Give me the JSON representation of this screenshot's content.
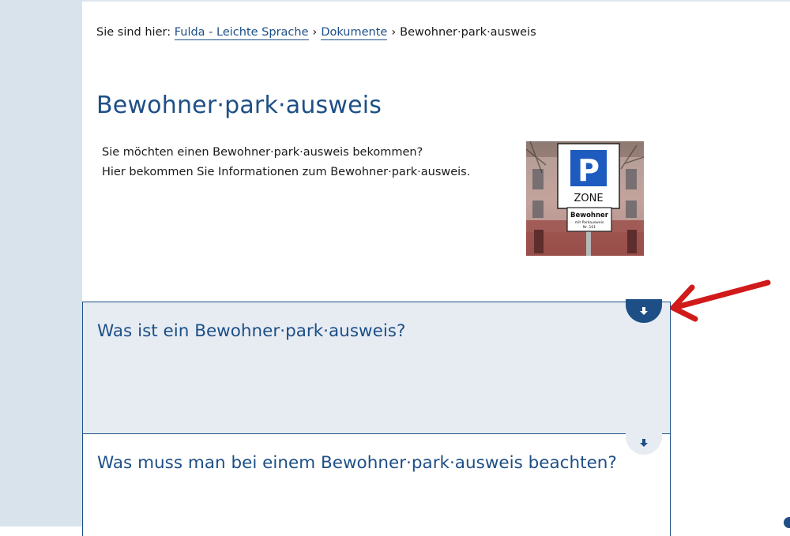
{
  "breadcrumb": {
    "prefix": "Sie sind hier:",
    "links": [
      "Fulda - Leichte Sprache",
      "Dokumente"
    ],
    "separator": "›",
    "current": "Bewohner·park·ausweis"
  },
  "page": {
    "title": "Bewohner·park·ausweis",
    "intro_lines": [
      "Sie möchten einen Bewohner·park·ausweis bekommen?",
      "Hier bekommen Sie Informationen zum Bewohner·park·ausweis."
    ]
  },
  "sign_image": {
    "main_letter": "P",
    "zone_label": "ZONE",
    "sub_sign_line1": "Bewohner",
    "sub_sign_line2": "mit Parkausweis",
    "sub_sign_line3": "Nr. 101"
  },
  "accordion": {
    "items": [
      {
        "title": "Was ist ein Bewohner·park·ausweis?",
        "expanded": true
      },
      {
        "title": "Was muss man bei einem Bewohner·park·ausweis beachten?",
        "expanded": false
      }
    ]
  },
  "colors": {
    "primary": "#1d4f86",
    "left_band": "#d9e3ec",
    "accordion_bg": "#e7ecf3",
    "annotation_arrow": "#d11a1a"
  },
  "icons": {
    "toggle": "arrow-down-icon",
    "annotation": "red-arrow-annotation"
  }
}
